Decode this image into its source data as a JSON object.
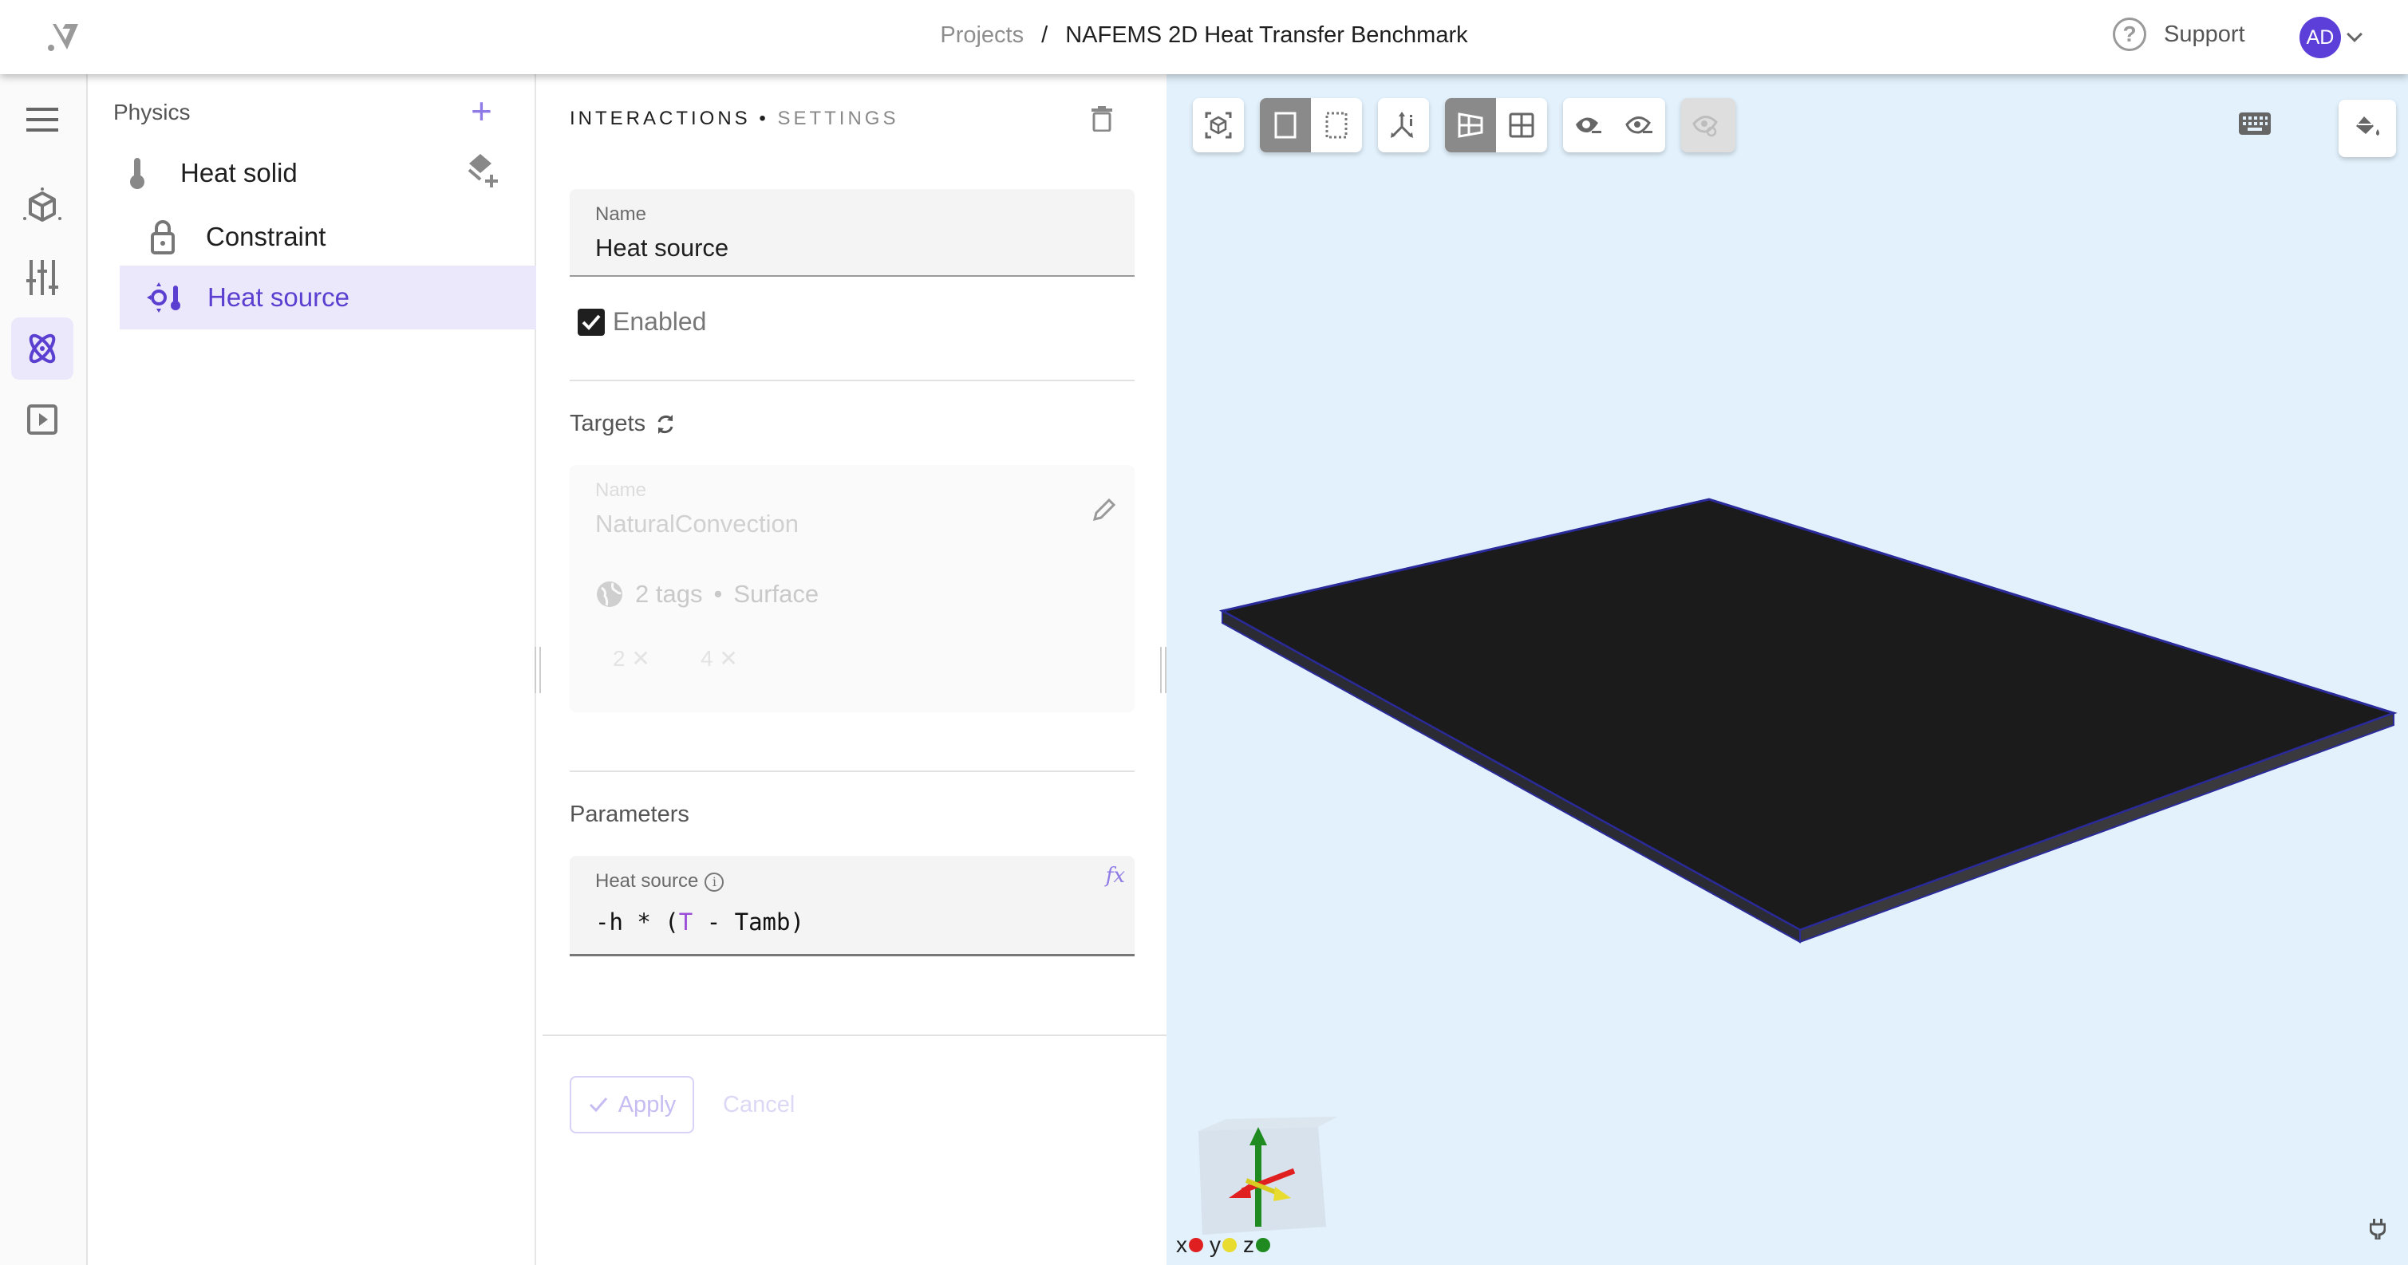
{
  "app": {
    "logo": "app-logo"
  },
  "breadcrumb": {
    "parent": "Projects",
    "separator": "/",
    "current": "NAFEMS 2D Heat Transfer Benchmark"
  },
  "header": {
    "support_label": "Support",
    "avatar_initials": "AD",
    "accent_color": "#5c3fd8"
  },
  "rail": {
    "items": [
      {
        "icon": "menu-icon",
        "label": "Menu"
      },
      {
        "icon": "geometry-cube-icon",
        "label": "Geometry"
      },
      {
        "icon": "sliders-icon",
        "label": "Settings"
      },
      {
        "icon": "physics-atom-icon",
        "label": "Physics",
        "active": true
      },
      {
        "icon": "run-play-icon",
        "label": "Run"
      }
    ]
  },
  "tree": {
    "title": "Physics",
    "add_label": "+",
    "items": [
      {
        "label": "Heat solid",
        "icon": "thermometer-icon",
        "level": 0
      },
      {
        "label": "Constraint",
        "icon": "lock-icon",
        "level": 1
      },
      {
        "label": "Heat source",
        "icon": "heat-source-icon",
        "level": 1,
        "selected": true
      }
    ]
  },
  "settings": {
    "title_primary": "INTERACTIONS",
    "title_separator": "•",
    "title_secondary": "SETTINGS",
    "name_label": "Name",
    "name_value": "Heat source",
    "enabled_label": "Enabled",
    "enabled": true,
    "targets_label": "Targets",
    "target": {
      "name_label": "Name",
      "name_value": "NaturalConvection",
      "summary_count": "2 tags",
      "summary_sep": "•",
      "summary_type": "Surface",
      "chips": [
        "2",
        "4"
      ]
    },
    "parameters_label": "Parameters",
    "heat_source": {
      "label": "Heat source",
      "fx_label": "fx",
      "expr_pre": "-h * (",
      "expr_var": "T",
      "expr_post": " - Tamb)"
    },
    "apply_label": "Apply",
    "cancel_label": "Cancel"
  },
  "viewport": {
    "background": "#e2f1fc",
    "toolbar": [
      {
        "group": "fit",
        "buttons": [
          {
            "icon": "fit-view-icon",
            "on": false
          }
        ]
      },
      {
        "group": "selection",
        "buttons": [
          {
            "icon": "select-solid-icon",
            "on": true
          },
          {
            "icon": "select-box-icon",
            "on": false
          }
        ]
      },
      {
        "group": "axes",
        "buttons": [
          {
            "icon": "axes-info-icon",
            "on": false
          }
        ]
      },
      {
        "group": "view",
        "buttons": [
          {
            "icon": "perspective-icon",
            "on": true
          },
          {
            "icon": "grid-view-icon",
            "on": false
          }
        ]
      },
      {
        "group": "visibility",
        "buttons": [
          {
            "icon": "hide-icon",
            "on": false
          },
          {
            "icon": "show-icon",
            "on": false
          }
        ]
      },
      {
        "group": "reset-visibility",
        "buttons": [
          {
            "icon": "reset-visibility-icon",
            "on": false,
            "disabled": true
          }
        ]
      }
    ],
    "axes_legend": [
      {
        "axis": "x",
        "color": "#e02020"
      },
      {
        "axis": "y",
        "color": "#e8dc30"
      },
      {
        "axis": "z",
        "color": "#1f8a1f"
      }
    ]
  }
}
